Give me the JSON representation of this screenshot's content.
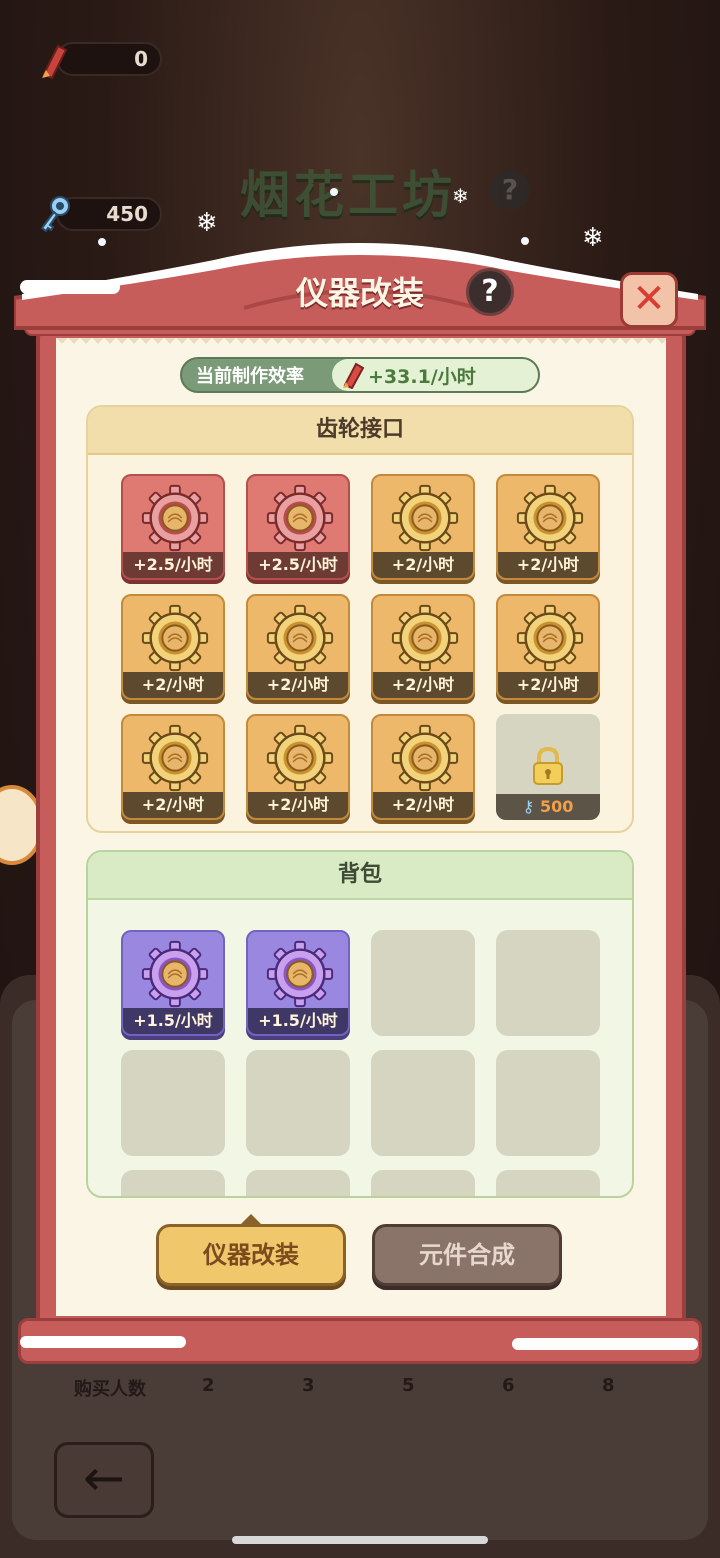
{
  "hud": {
    "rockets": "0",
    "keys": "450"
  },
  "background": {
    "title": "烟花工坊",
    "help": "?",
    "row_label": "购买人数",
    "row_values": [
      "2",
      "3",
      "5",
      "6",
      "8"
    ],
    "back_icon": "arrow-left-icon"
  },
  "modal": {
    "title": "仪器改装",
    "help": "?",
    "close": "✕",
    "efficiency_label": "当前制作效率",
    "efficiency_value": "+33.1/小时",
    "gear_section_title": "齿轮接口",
    "bag_section_title": "背包",
    "slots": [
      {
        "tier": "red",
        "rate": "+2.5/小时"
      },
      {
        "tier": "red",
        "rate": "+2.5/小时"
      },
      {
        "tier": "gold",
        "rate": "+2/小时"
      },
      {
        "tier": "gold",
        "rate": "+2/小时"
      },
      {
        "tier": "gold",
        "rate": "+2/小时"
      },
      {
        "tier": "gold",
        "rate": "+2/小时"
      },
      {
        "tier": "gold",
        "rate": "+2/小时"
      },
      {
        "tier": "gold",
        "rate": "+2/小时"
      },
      {
        "tier": "gold",
        "rate": "+2/小时"
      },
      {
        "tier": "gold",
        "rate": "+2/小时"
      },
      {
        "tier": "gold",
        "rate": "+2/小时"
      }
    ],
    "locked_slot_cost": "500",
    "bag_items": [
      {
        "tier": "purple",
        "rate": "+1.5/小时"
      },
      {
        "tier": "purple",
        "rate": "+1.5/小时"
      }
    ],
    "tabs": {
      "modify": "仪器改装",
      "synthesize": "元件合成"
    }
  },
  "colors": {
    "frame": "#c75d5a",
    "red_tier": "#df7a72",
    "gold_tier": "#eeb86a",
    "purple_tier": "#9a88e0"
  }
}
